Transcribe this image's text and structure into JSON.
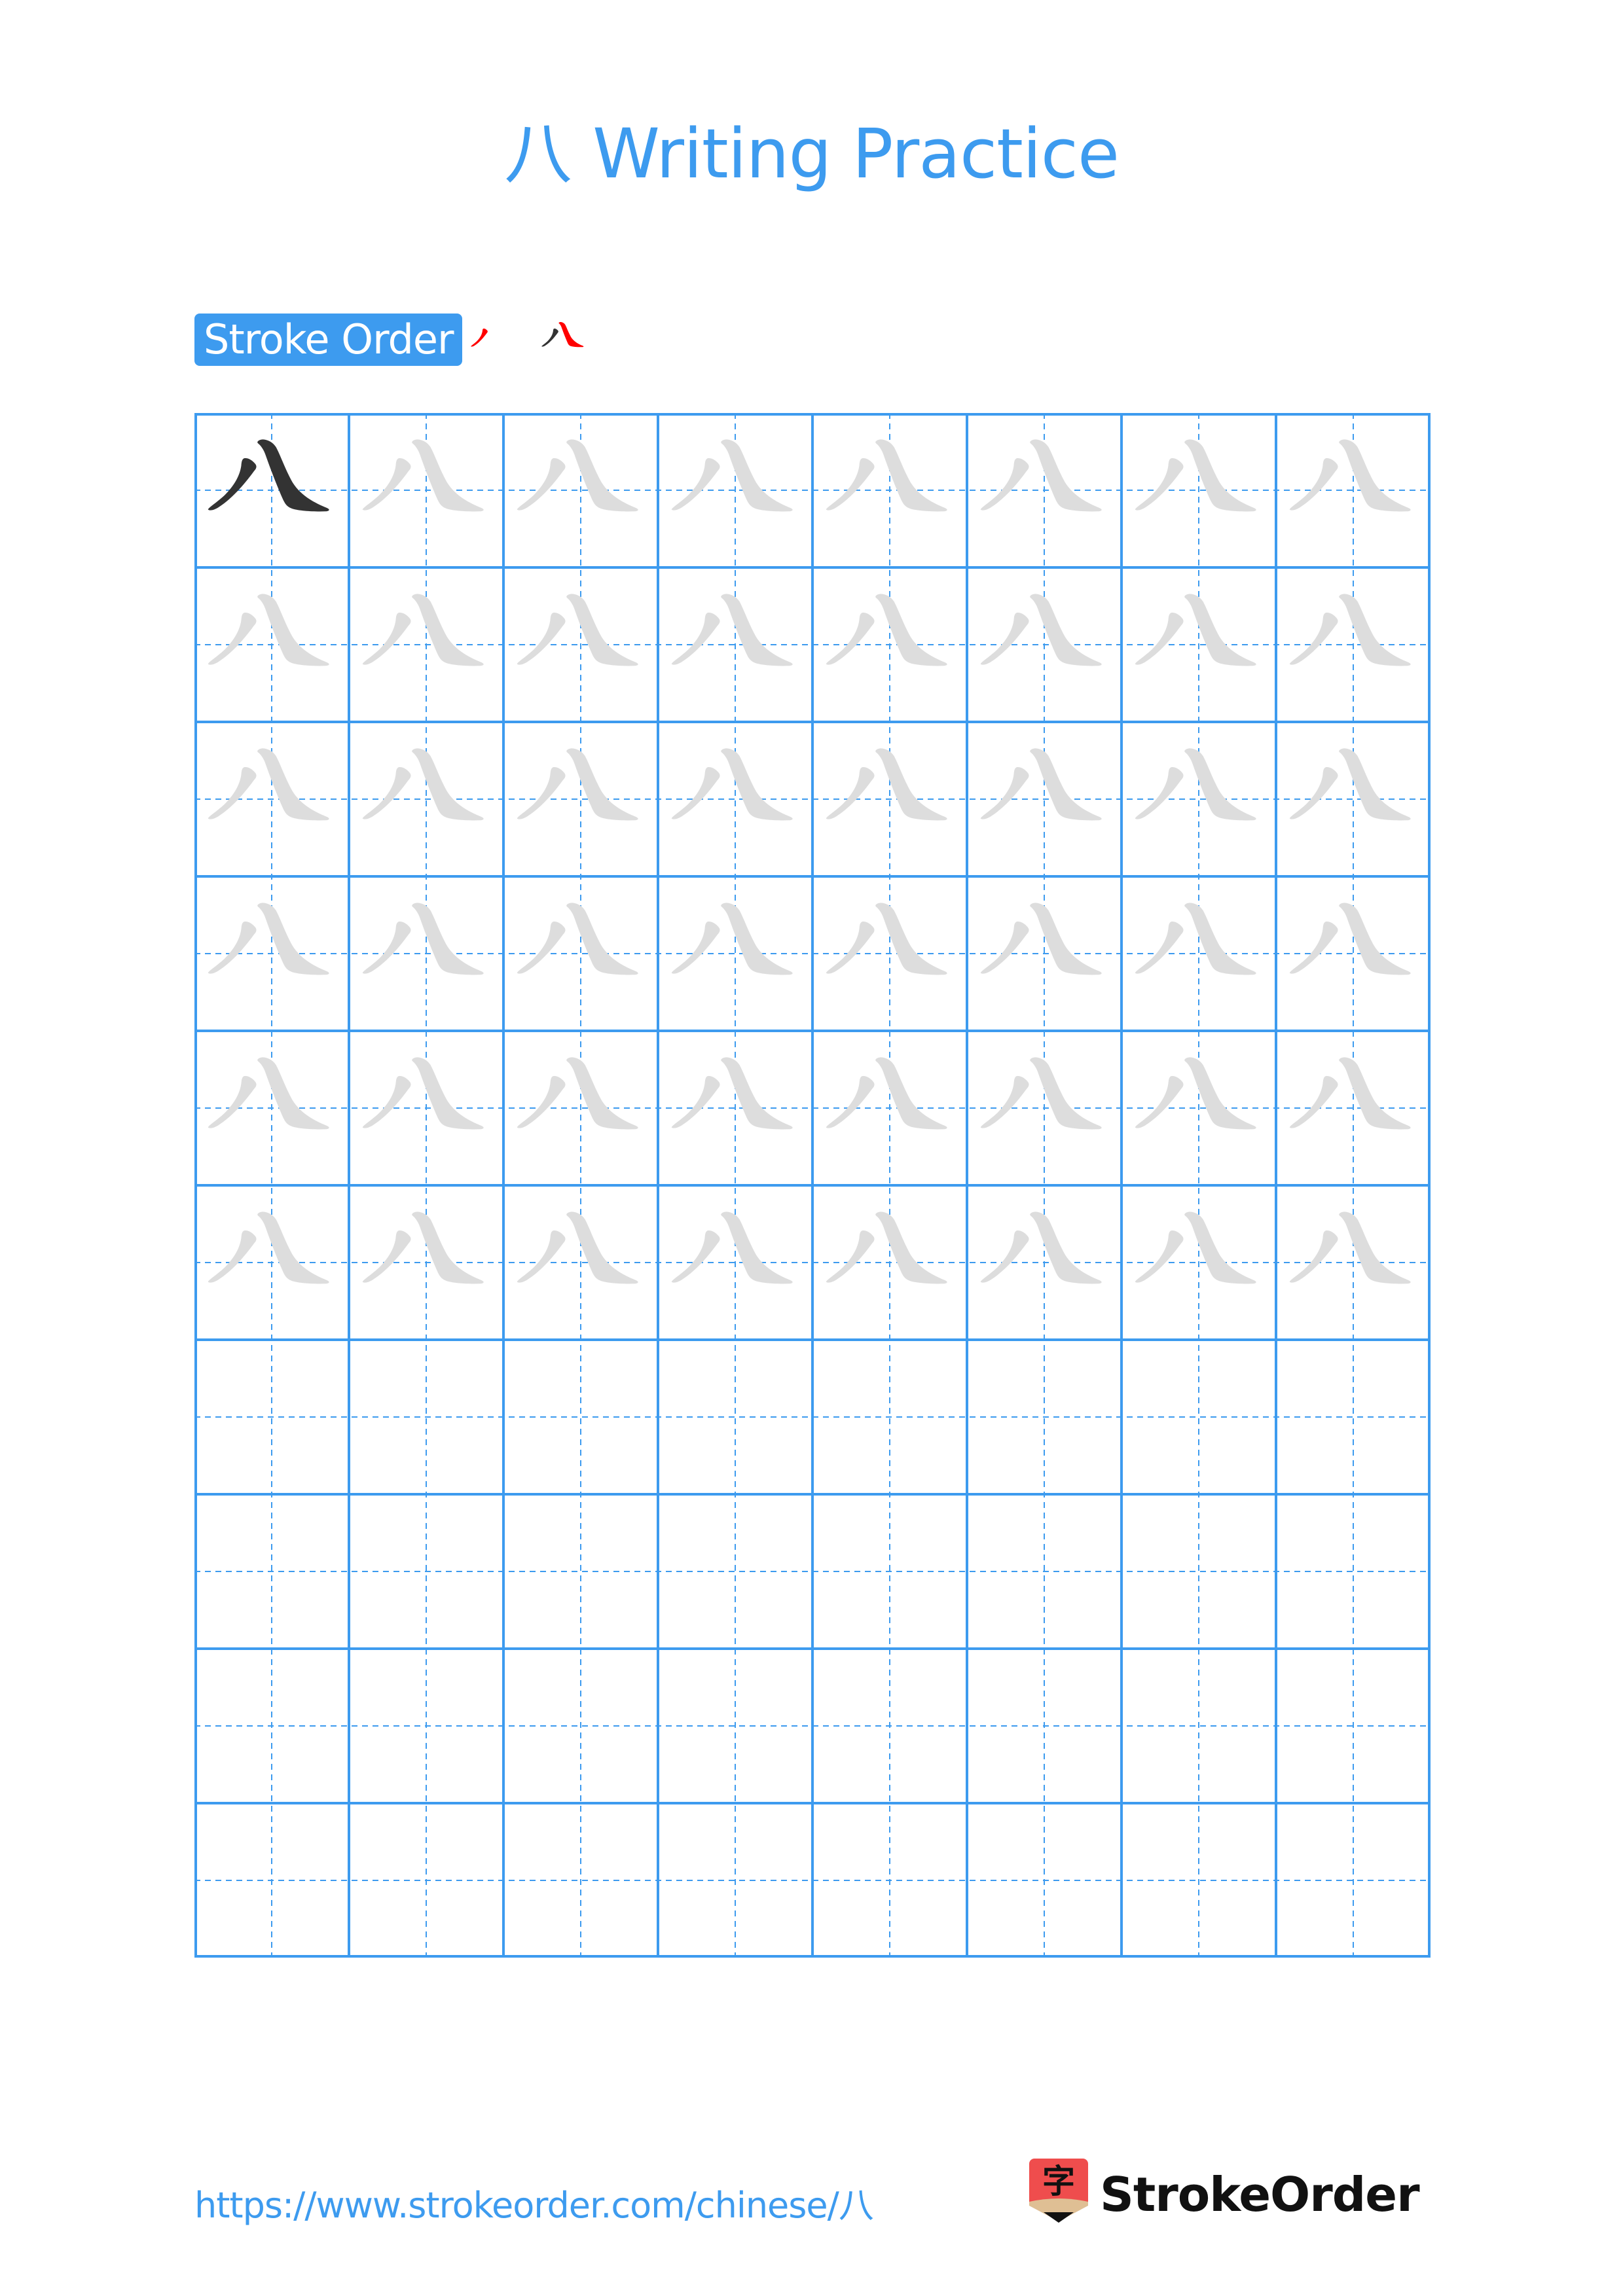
{
  "page": {
    "title": "八 Writing Practice",
    "character": "八"
  },
  "stroke_order": {
    "label": "Stroke Order",
    "steps": [
      {
        "step": 1,
        "strokes_drawn": 1,
        "highlight_stroke": 1
      },
      {
        "step": 2,
        "strokes_drawn": 2,
        "highlight_stroke": 2
      }
    ]
  },
  "grid": {
    "columns": 8,
    "rows": 10,
    "model_rows": 1,
    "trace_rows": 5,
    "blank_rows": 5
  },
  "colors": {
    "accent": "#3d9bef",
    "grid_line": "#3d9bef",
    "model_char": "#333333",
    "trace_char": "#dddddd",
    "highlight_stroke": "#ff0000",
    "logo_red": "#ef4d4d",
    "logo_tan": "#dfbf94"
  },
  "footer": {
    "url": "https://www.strokeorder.com/chinese/八",
    "brand": "StrokeOrder",
    "logo_glyph": "字"
  }
}
